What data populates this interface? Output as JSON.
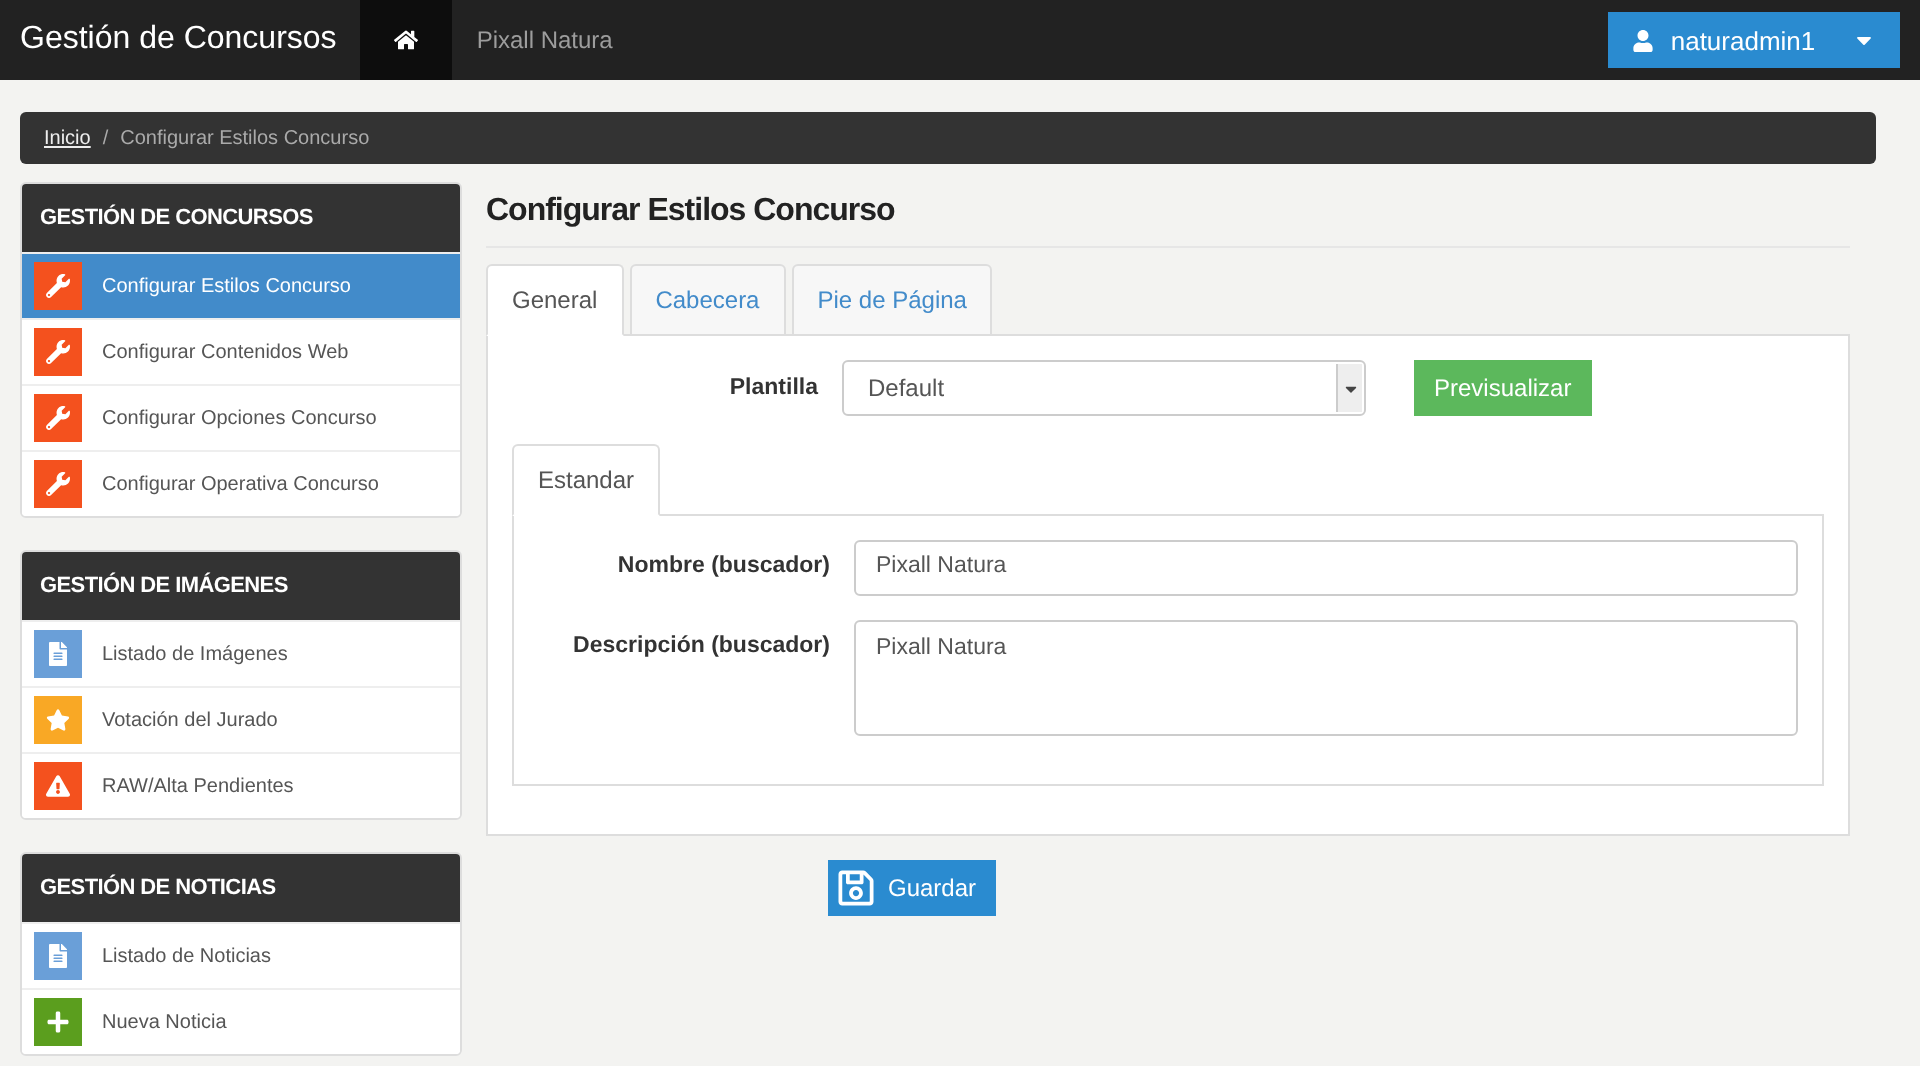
{
  "navbar": {
    "brand": "Gestión de Concursos",
    "home_selected": true,
    "link": "Pixall Natura",
    "user": "naturadmin1"
  },
  "breadcrumb": [
    {
      "label": "Inicio",
      "kind": "link"
    },
    {
      "label": "/",
      "kind": "separator"
    },
    {
      "label": "Configurar Estilos Concurso",
      "kind": "current"
    }
  ],
  "sidebar": [
    {
      "title": "GESTIÓN DE CONCURSOS",
      "items": [
        {
          "label": "Configurar Estilos Concurso",
          "kind": "wrench",
          "color": "#f4511e",
          "selected": true
        },
        {
          "label": "Configurar Contenidos Web",
          "kind": "wrench",
          "color": "#f4511e",
          "selected": false
        },
        {
          "label": "Configurar Opciones Concurso",
          "kind": "wrench",
          "color": "#f4511e",
          "selected": false
        },
        {
          "label": "Configurar Operativa Concurso",
          "kind": "wrench",
          "color": "#f4511e",
          "selected": false
        }
      ]
    },
    {
      "title": "GESTIÓN DE IMÁGENES",
      "items": [
        {
          "label": "Listado de Imágenes",
          "kind": "document",
          "color": "#6a9fd8",
          "selected": false
        },
        {
          "label": "Votación del Jurado",
          "kind": "star",
          "color": "#f9a825",
          "selected": false
        },
        {
          "label": "RAW/Alta Pendientes",
          "kind": "warning",
          "color": "#f4511e",
          "selected": false
        }
      ]
    },
    {
      "title": "GESTIÓN DE NOTICIAS",
      "items": [
        {
          "label": "Listado de Noticias",
          "kind": "document",
          "color": "#6a9fd8",
          "selected": false
        },
        {
          "label": "Nueva Noticia",
          "kind": "plus",
          "color": "#5b9e1e",
          "selected": false
        }
      ]
    }
  ],
  "main": {
    "title": "Configurar Estilos Concurso",
    "tabs": [
      {
        "label": "General",
        "selected": true
      },
      {
        "label": "Cabecera",
        "selected": false
      },
      {
        "label": "Pie de Página",
        "selected": false
      }
    ],
    "template": {
      "label": "Plantilla",
      "value": "Default",
      "button": "Previsualizar"
    },
    "subtabs": [
      {
        "label": "Estandar",
        "selected": true
      }
    ],
    "fields": [
      {
        "label": "Nombre (buscador)",
        "value": "Pixall Natura",
        "kind": "input"
      },
      {
        "label": "Descripción (buscador)",
        "value": "Pixall Natura",
        "kind": "textarea"
      }
    ],
    "save": "Guardar"
  }
}
